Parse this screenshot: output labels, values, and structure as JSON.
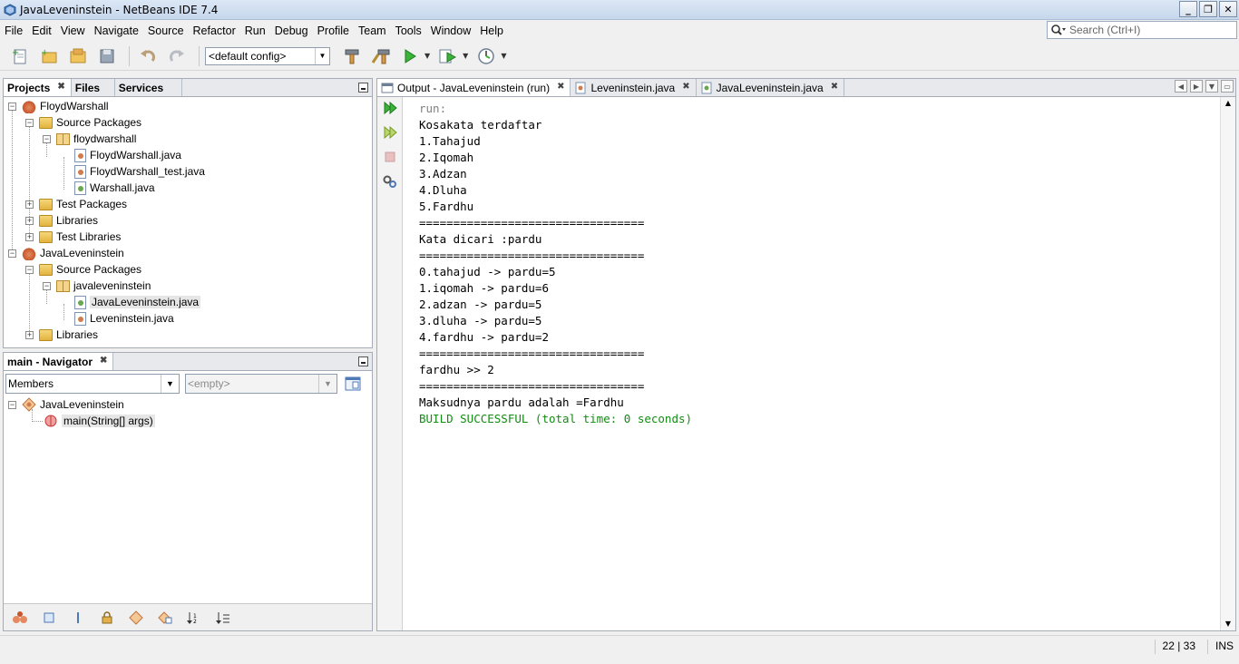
{
  "window": {
    "title": "JavaLeveninstein - NetBeans IDE 7.4"
  },
  "menu": [
    "File",
    "Edit",
    "View",
    "Navigate",
    "Source",
    "Refactor",
    "Run",
    "Debug",
    "Profile",
    "Team",
    "Tools",
    "Window",
    "Help"
  ],
  "search": {
    "placeholder": "Search (Ctrl+I)"
  },
  "toolbar": {
    "config": "<default config>"
  },
  "projects_panel": {
    "tabs": [
      "Projects",
      "Files",
      "Services"
    ],
    "tree": {
      "p1": "FloydWarshall",
      "p1_src": "Source Packages",
      "p1_pkg": "floydwarshall",
      "p1_f1": "FloydWarshall.java",
      "p1_f2": "FloydWarshall_test.java",
      "p1_f3": "Warshall.java",
      "p1_test": "Test Packages",
      "p1_libs": "Libraries",
      "p1_testlibs": "Test Libraries",
      "p2": "JavaLeveninstein",
      "p2_src": "Source Packages",
      "p2_pkg": "javaleveninstein",
      "p2_f1": "JavaLeveninstein.java",
      "p2_f2": "Leveninstein.java",
      "p2_libs": "Libraries"
    }
  },
  "navigator": {
    "title": "main - Navigator",
    "filter": "Members",
    "empty": "<empty>",
    "class_name": "JavaLeveninstein",
    "method": "main(String[] args)"
  },
  "editor_tabs": [
    "Output - JavaLeveninstein (run)",
    "Leveninstein.java",
    "JavaLeveninstein.java"
  ],
  "output": {
    "lines": [
      "run:",
      "Kosakata terdaftar",
      "1.Tahajud",
      "2.Iqomah",
      "3.Adzan",
      "4.Dluha",
      "5.Fardhu",
      "=================================",
      "Kata dicari :pardu",
      "=================================",
      "0.tahajud -> pardu=5",
      "1.iqomah -> pardu=6",
      "2.adzan -> pardu=5",
      "3.dluha -> pardu=5",
      "4.fardhu -> pardu=2",
      "=================================",
      "fardhu >> 2",
      "=================================",
      "Maksudnya pardu adalah =Fardhu",
      "BUILD SUCCESSFUL (total time: 0 seconds)"
    ]
  },
  "status": {
    "position": "22 | 33",
    "mode": "INS"
  },
  "colors": {
    "build_success": "#128c12",
    "run_text": "#7f7f7f"
  }
}
